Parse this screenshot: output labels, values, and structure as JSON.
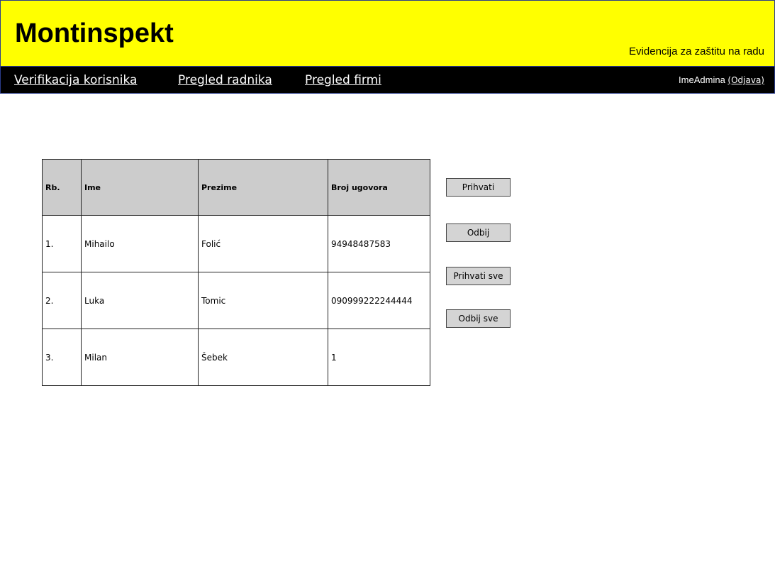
{
  "header": {
    "brand": "Montinspekt",
    "tagline": "Evidencija za zaštitu na radu"
  },
  "nav": {
    "items": [
      {
        "label": "Verifikacija korisnika"
      },
      {
        "label": "Pregled radnika"
      },
      {
        "label": "Pregled firmi"
      }
    ],
    "user": "ImeAdmina",
    "logout": "(Odjava)"
  },
  "table": {
    "columns": [
      "Rb.",
      "Ime",
      "Prezime",
      "Broj ugovora"
    ],
    "rows": [
      {
        "rb": "1.",
        "ime": "Mihailo",
        "prezime": "Folić",
        "ugovor": "94948487583"
      },
      {
        "rb": "2.",
        "ime": "Luka",
        "prezime": "Tomic",
        "ugovor": "090999222244444"
      },
      {
        "rb": "3.",
        "ime": "Milan",
        "prezime": "Šebek",
        "ugovor": "1"
      }
    ]
  },
  "actions": {
    "accept": "Prihvati",
    "reject": "Odbij",
    "accept_all": "Prihvati sve",
    "reject_all": "Odbij sve"
  },
  "colors": {
    "header_bg": "#ffff00",
    "navbar_bg": "#000000",
    "table_header_bg": "#cccccc",
    "button_bg": "#d4d4d4"
  }
}
